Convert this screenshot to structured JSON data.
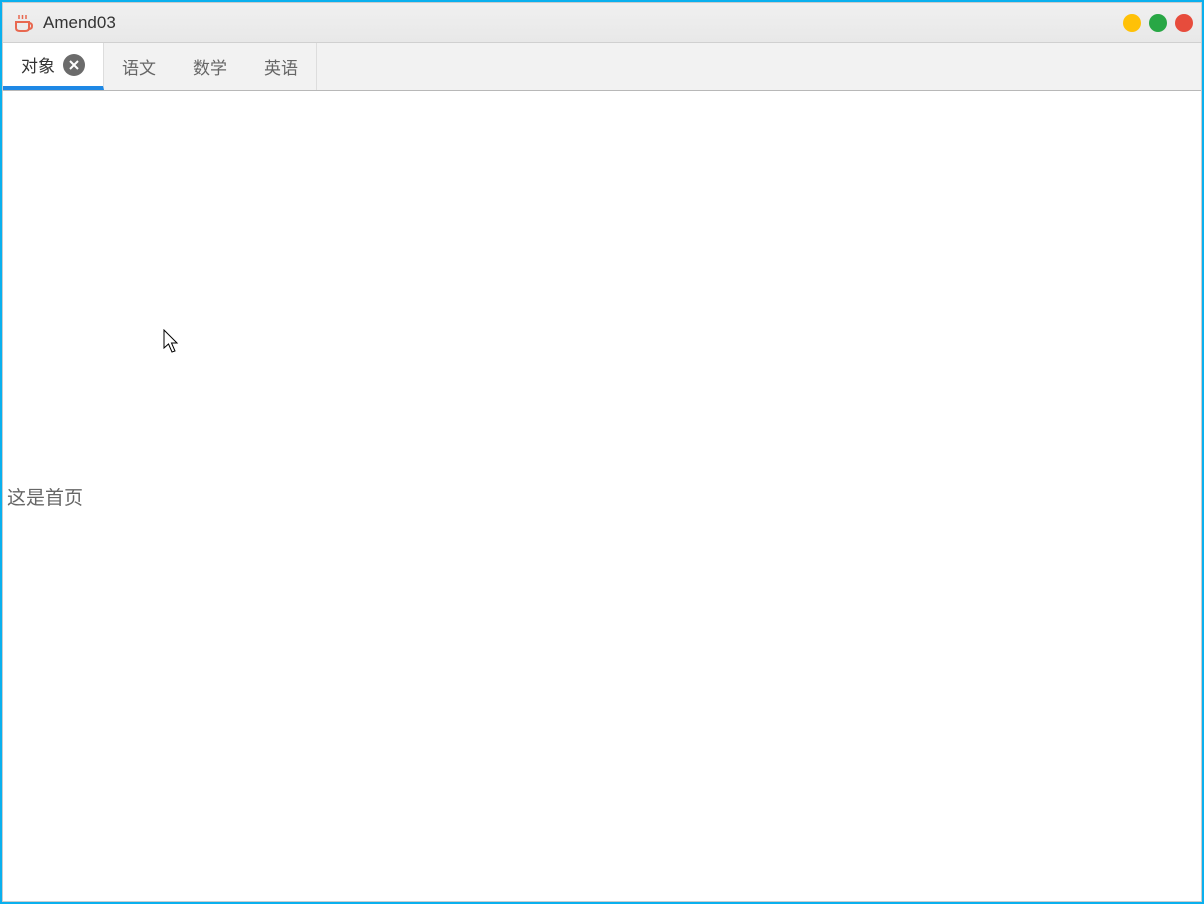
{
  "window": {
    "title": "Amend03"
  },
  "tabs": [
    {
      "label": "对象",
      "closable": true,
      "active": true
    },
    {
      "label": "语文",
      "closable": false,
      "active": false
    },
    {
      "label": "数学",
      "closable": false,
      "active": false
    },
    {
      "label": "英语",
      "closable": false,
      "active": false
    }
  ],
  "content": {
    "text": "这是首页"
  }
}
